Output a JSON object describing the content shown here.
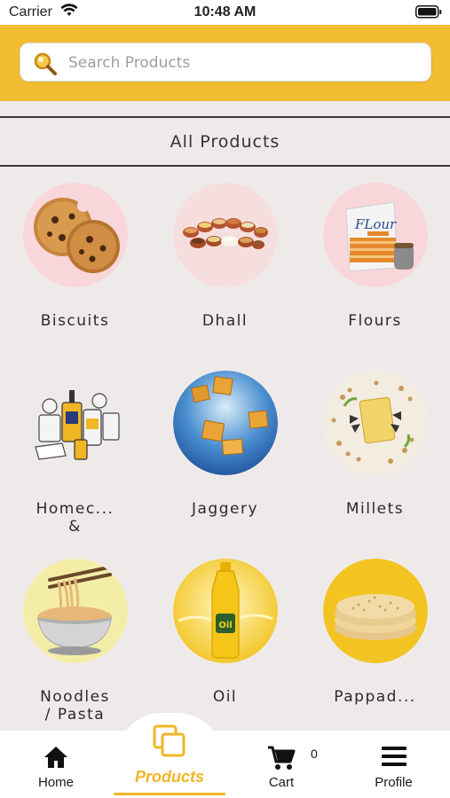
{
  "status_bar": {
    "carrier": "Carrier",
    "time": "10:48 AM"
  },
  "search": {
    "placeholder": "Search Products",
    "value": ""
  },
  "section": {
    "title": "All Products"
  },
  "categories": [
    {
      "label": "Biscuits"
    },
    {
      "label": "Dhall"
    },
    {
      "label": "Flours"
    },
    {
      "label": "Homec...\n&"
    },
    {
      "label": "Jaggery"
    },
    {
      "label": "Millets"
    },
    {
      "label": "Noodles\n/ Pasta"
    },
    {
      "label": "Oil"
    },
    {
      "label": "Pappad..."
    }
  ],
  "tabbar": {
    "home": "Home",
    "products": "Products",
    "cart": "Cart",
    "cart_count": "0",
    "profile": "Profile"
  },
  "colors": {
    "accent": "#f3bd32",
    "active_tab": "#f0b624",
    "background": "#efeaea"
  }
}
